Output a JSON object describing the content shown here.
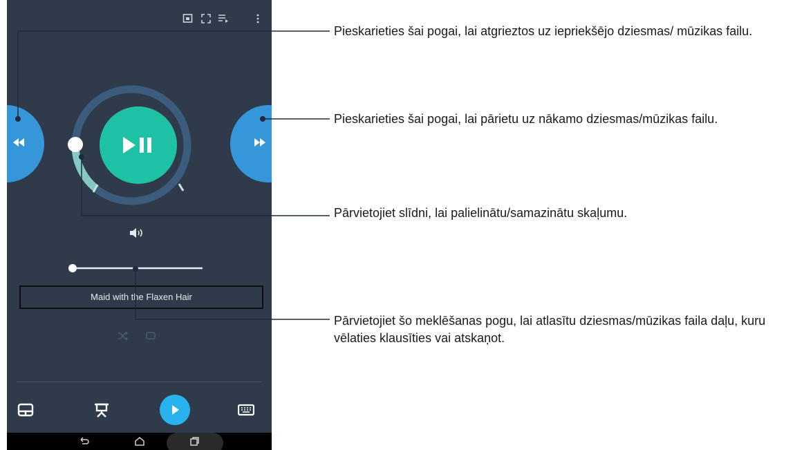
{
  "screen": {
    "top_icons": [
      "cast-icon",
      "fullscreen-icon",
      "playlist-icon",
      "more-icon"
    ],
    "track_title": "Maid with the Flaxen Hair",
    "volume_level": 0.2,
    "seek_position": 0.0,
    "playback_progress": 0.48,
    "colors": {
      "screen_bg": "#2f3a4b",
      "side_button": "#3597da",
      "play_button": "#1fc1a4",
      "small_play": "#28b3ee"
    },
    "bottom_icons": [
      "touchpad-icon",
      "presentation-icon",
      "play-icon",
      "keyboard-icon"
    ],
    "nav_icons": [
      "back-icon",
      "home-icon",
      "recent-apps-icon"
    ]
  },
  "callouts": [
    {
      "text": "Pieskarieties šai pogai, lai atgrieztos uz iepriekšējo dziesmas/ mūzikas failu."
    },
    {
      "text": "Pieskarieties šai pogai, lai pārietu uz nākamo dziesmas/mūzikas failu."
    },
    {
      "text": "Pārvietojiet slīdni, lai palielinātu/samazinātu skaļumu."
    },
    {
      "text": "Pārvietojiet šo meklēšanas pogu, lai atlasītu dziesmas/mūzikas faila daļu, kuru vēlaties klausīties vai atskaņot."
    }
  ]
}
